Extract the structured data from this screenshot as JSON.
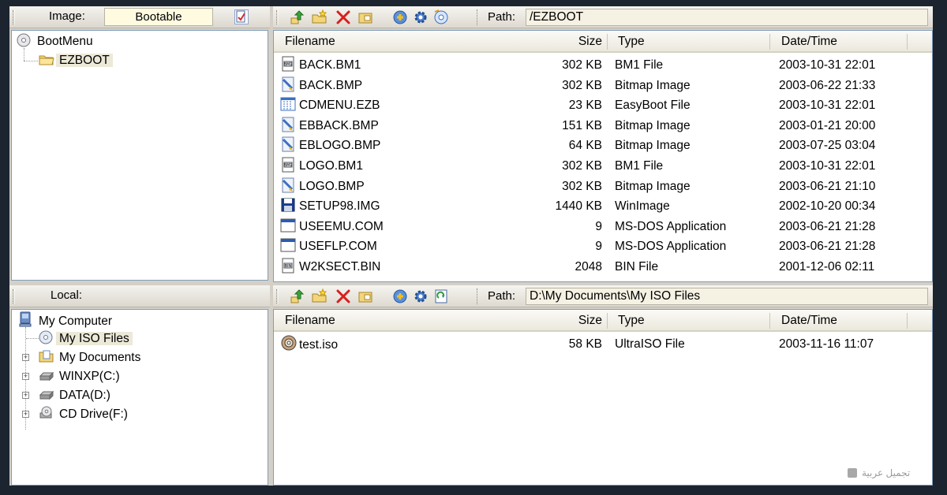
{
  "image_panel": {
    "label": "Image:",
    "image_type": "Bootable",
    "tree": [
      {
        "label": "BootMenu",
        "icon": "cd-icon"
      },
      {
        "label": "EZBOOT",
        "icon": "folder-icon",
        "selected": true
      }
    ]
  },
  "image_toolbar": {
    "path_label": "Path:",
    "path_value": "/EZBOOT"
  },
  "image_list": {
    "columns": [
      "Filename",
      "Size",
      "Type",
      "Date/Time"
    ],
    "rows": [
      {
        "name": "BACK.BM1",
        "size": "302 KB",
        "type": "BM1 File",
        "date": "2003-10-31 22:01",
        "icon": "bm1-file-icon"
      },
      {
        "name": "BACK.BMP",
        "size": "302 KB",
        "type": "Bitmap Image",
        "date": "2003-06-22 21:33",
        "icon": "bitmap-file-icon"
      },
      {
        "name": "CDMENU.EZB",
        "size": "23 KB",
        "type": "EasyBoot File",
        "date": "2003-10-31 22:01",
        "icon": "ezb-file-icon"
      },
      {
        "name": "EBBACK.BMP",
        "size": "151 KB",
        "type": "Bitmap Image",
        "date": "2003-01-21 20:00",
        "icon": "bitmap-file-icon"
      },
      {
        "name": "EBLOGO.BMP",
        "size": "64 KB",
        "type": "Bitmap Image",
        "date": "2003-07-25 03:04",
        "icon": "bitmap-file-icon"
      },
      {
        "name": "LOGO.BM1",
        "size": "302 KB",
        "type": "BM1 File",
        "date": "2003-10-31 22:01",
        "icon": "bm1-file-icon"
      },
      {
        "name": "LOGO.BMP",
        "size": "302 KB",
        "type": "Bitmap Image",
        "date": "2003-06-21 21:10",
        "icon": "bitmap-file-icon"
      },
      {
        "name": "SETUP98.IMG",
        "size": "1440 KB",
        "type": "WinImage",
        "date": "2002-10-20 00:34",
        "icon": "floppy-file-icon"
      },
      {
        "name": "USEEMU.COM",
        "size": "9",
        "type": "MS-DOS Application",
        "date": "2003-06-21 21:28",
        "icon": "dos-app-icon"
      },
      {
        "name": "USEFLP.COM",
        "size": "9",
        "type": "MS-DOS Application",
        "date": "2003-06-21 21:28",
        "icon": "dos-app-icon"
      },
      {
        "name": "W2KSECT.BIN",
        "size": "2048",
        "type": "BIN File",
        "date": "2001-12-06 02:11",
        "icon": "bin-file-icon"
      }
    ]
  },
  "local_panel": {
    "label": "Local:",
    "tree": [
      {
        "label": "My Computer",
        "icon": "computer-icon"
      },
      {
        "label": "My ISO Files",
        "icon": "iso-folder-icon",
        "selected": true
      },
      {
        "label": "My Documents",
        "icon": "documents-folder-icon"
      },
      {
        "label": "WINXP(C:)",
        "icon": "hard-drive-icon"
      },
      {
        "label": "DATA(D:)",
        "icon": "hard-drive-icon"
      },
      {
        "label": "CD Drive(F:)",
        "icon": "cd-drive-icon"
      }
    ]
  },
  "local_toolbar": {
    "path_label": "Path:",
    "path_value": "D:\\My Documents\\My ISO Files"
  },
  "local_list": {
    "columns": [
      "Filename",
      "Size",
      "Type",
      "Date/Time"
    ],
    "rows": [
      {
        "name": "test.iso",
        "size": "58 KB",
        "type": "UltraISO File",
        "date": "2003-11-16 11:07",
        "icon": "iso-file-icon"
      }
    ]
  },
  "watermark": {
    "text": "تجميل عربية"
  },
  "colors": {
    "selection": "#ece9d8",
    "border": "#7f9db9",
    "panel": "#d4d0c8"
  }
}
